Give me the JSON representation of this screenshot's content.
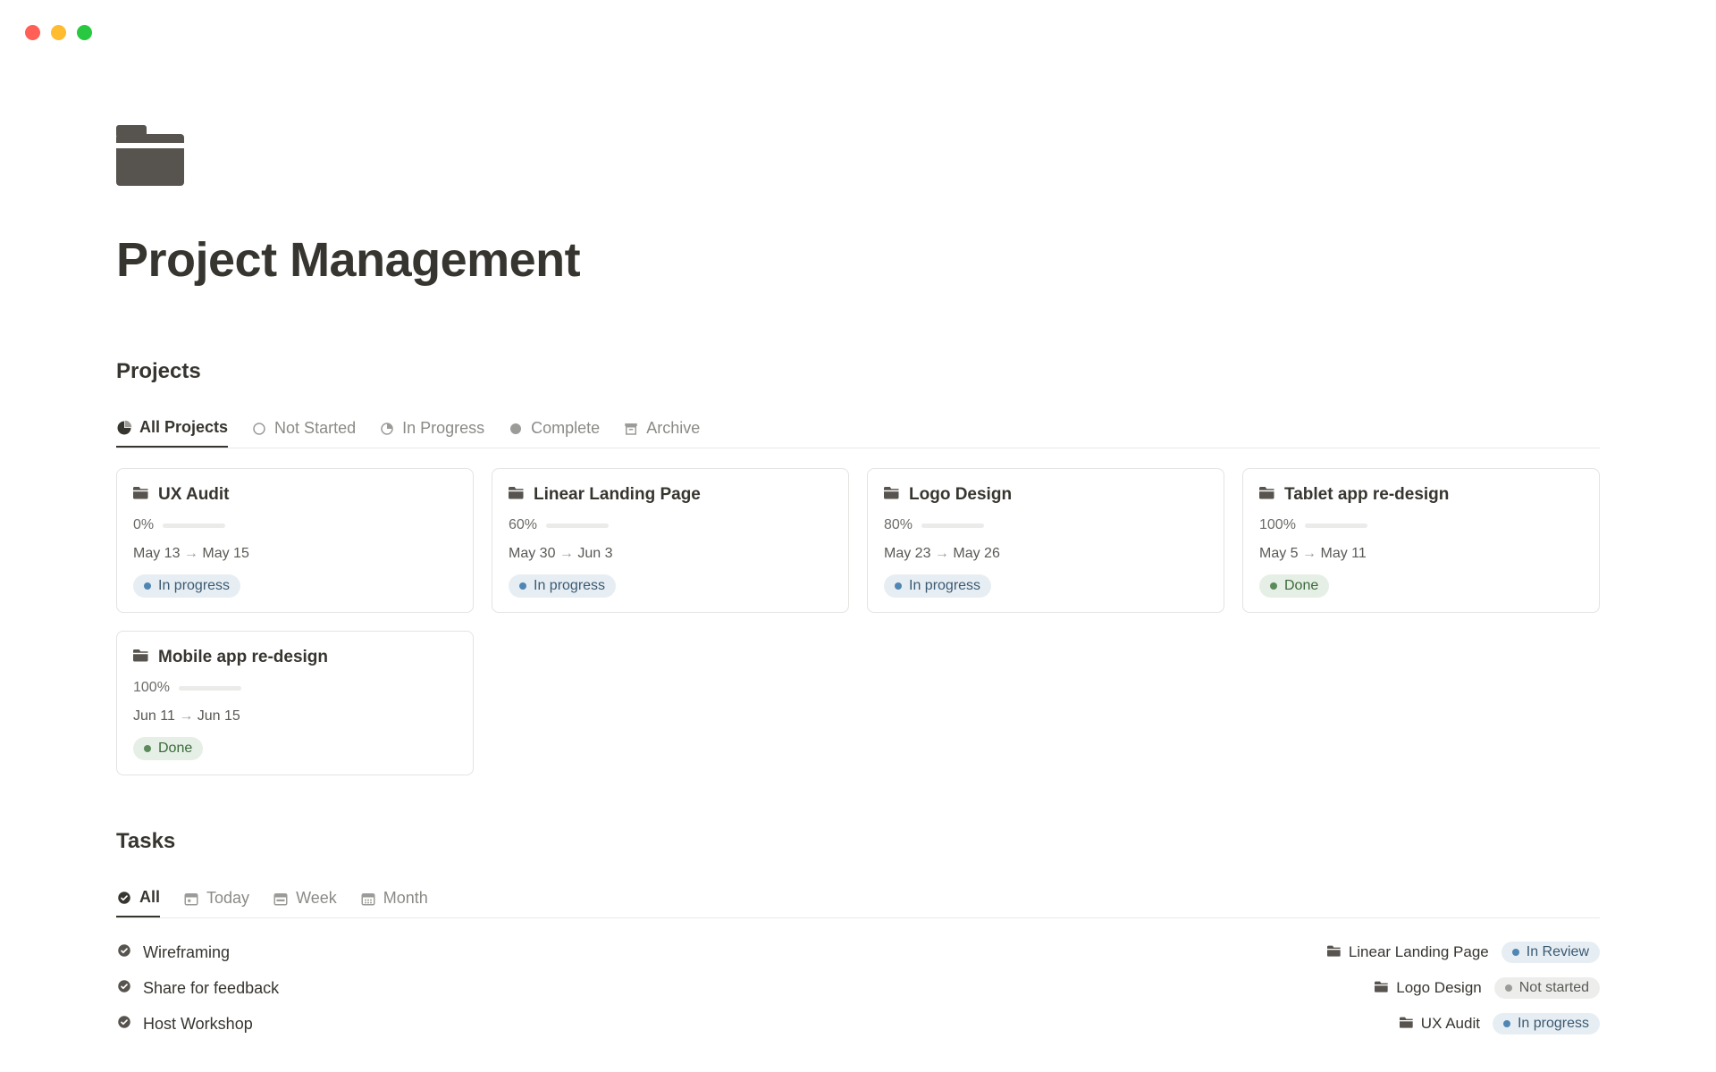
{
  "header": {
    "title": "Project Management"
  },
  "projects": {
    "heading": "Projects",
    "tabs": [
      {
        "label": "All Projects"
      },
      {
        "label": "Not Started"
      },
      {
        "label": "In Progress"
      },
      {
        "label": "Complete"
      },
      {
        "label": "Archive"
      }
    ],
    "cards": [
      {
        "title": "UX Audit",
        "percent": "0%",
        "progress": 0,
        "date_start": "May 13",
        "date_end": "May 15",
        "status": "In progress",
        "status_kind": "inprogress"
      },
      {
        "title": "Linear Landing Page",
        "percent": "60%",
        "progress": 60,
        "date_start": "May 30",
        "date_end": "Jun 3",
        "status": "In progress",
        "status_kind": "inprogress"
      },
      {
        "title": "Logo Design",
        "percent": "80%",
        "progress": 80,
        "date_start": "May 23",
        "date_end": "May 26",
        "status": "In progress",
        "status_kind": "inprogress"
      },
      {
        "title": "Tablet app re-design",
        "percent": "100%",
        "progress": 100,
        "date_start": "May 5",
        "date_end": "May 11",
        "status": "Done",
        "status_kind": "done"
      },
      {
        "title": "Mobile app re-design",
        "percent": "100%",
        "progress": 100,
        "date_start": "Jun 11",
        "date_end": "Jun 15",
        "status": "Done",
        "status_kind": "done"
      }
    ]
  },
  "tasks": {
    "heading": "Tasks",
    "tabs": [
      {
        "label": "All"
      },
      {
        "label": "Today"
      },
      {
        "label": "Week"
      },
      {
        "label": "Month"
      }
    ],
    "items": [
      {
        "title": "Wireframing",
        "project": "Linear Landing Page",
        "status": "In Review",
        "status_kind": "inreview"
      },
      {
        "title": "Share for feedback",
        "project": "Logo Design",
        "status": "Not started",
        "status_kind": "notstarted"
      },
      {
        "title": "Host Workshop",
        "project": "UX Audit",
        "status": "In progress",
        "status_kind": "inprogress"
      }
    ]
  }
}
